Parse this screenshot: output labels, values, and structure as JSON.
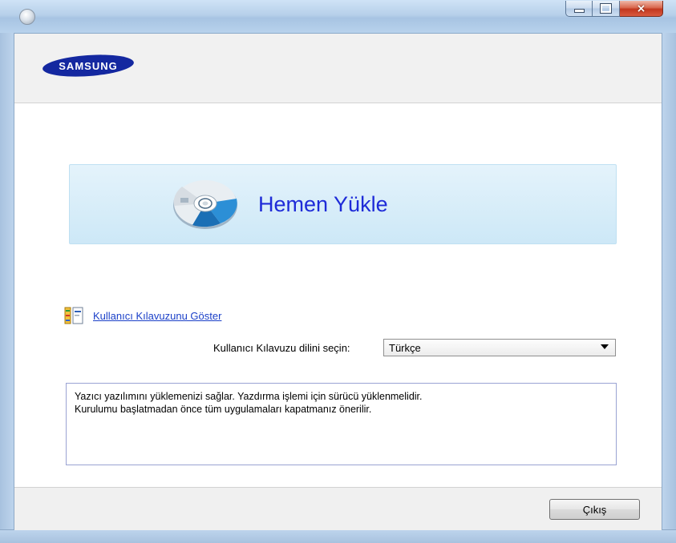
{
  "window": {
    "controls": {
      "minimize": "minimize-icon",
      "maximize": "maximize-icon",
      "close": "×"
    }
  },
  "header": {
    "logo_text": "SAMSUNG",
    "logo_color": "#1428a0"
  },
  "banner": {
    "title": "Hemen Yükle",
    "title_color": "#1e2bd8",
    "icon": "cd-disc-icon"
  },
  "guide": {
    "link_label": "Kullanıcı Kılavuzunu Göster",
    "icon": "manual-book-icon",
    "language_label": "Kullanıcı Kılavuzu dilini seçin:",
    "language_selected": "Türkçe"
  },
  "description": {
    "line1": "Yazıcı yazılımını yüklemenizi sağlar. Yazdırma işlemi için sürücü yüklenmelidir.",
    "line2": "Kurulumu başlatmadan önce tüm uygulamaları kapatmanız önerilir."
  },
  "footer": {
    "exit_label": "Çıkış"
  }
}
